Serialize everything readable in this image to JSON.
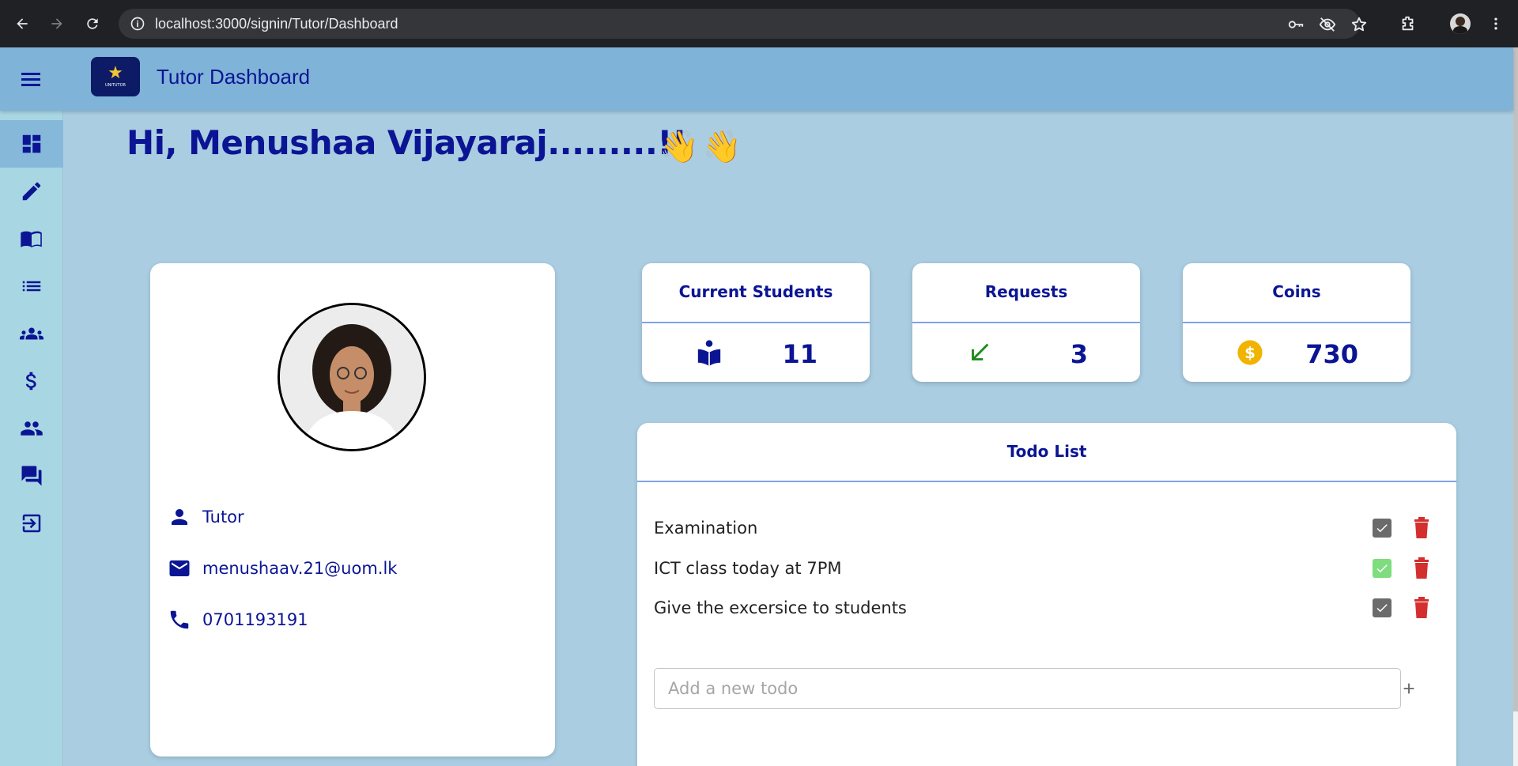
{
  "browser": {
    "url": "localhost:3000/signin/Tutor/Dashboard",
    "icons": [
      "back-icon",
      "forward-icon",
      "reload-icon",
      "site-info-icon",
      "key-icon",
      "eye-off-icon",
      "star-icon",
      "extensions-icon",
      "profile-icon",
      "more-icon"
    ]
  },
  "header": {
    "title": "Tutor Dashboard",
    "logo_brand": "UNITUTOR"
  },
  "sidebar": {
    "items": [
      {
        "name": "dashboard",
        "icon": "dashboard-icon",
        "active": true
      },
      {
        "name": "edit",
        "icon": "pencil-icon"
      },
      {
        "name": "courses",
        "icon": "book-icon"
      },
      {
        "name": "list",
        "icon": "list-icon"
      },
      {
        "name": "students",
        "icon": "groups-icon"
      },
      {
        "name": "payments",
        "icon": "dollar-icon"
      },
      {
        "name": "people",
        "icon": "people-icon"
      },
      {
        "name": "messages",
        "icon": "chat-icon"
      },
      {
        "name": "logout",
        "icon": "logout-icon"
      }
    ]
  },
  "greeting": {
    "text": "Hi, Menushaa Vijayaraj.........!!",
    "emoji1": "👋",
    "emoji2": "👋"
  },
  "profile": {
    "role": "Tutor",
    "email": "menushaav.21@uom.lk",
    "phone": "0701193191"
  },
  "stats": [
    {
      "title": "Current Students",
      "value": "11",
      "icon": "reader-icon",
      "color": "#0b1594"
    },
    {
      "title": "Requests",
      "value": "3",
      "icon": "arrow-down-left-icon",
      "color": "#1a8a1a"
    },
    {
      "title": "Coins",
      "value": "730",
      "icon": "coin-icon",
      "color": "#f0b400"
    }
  ],
  "todo": {
    "title": "Todo List",
    "items": [
      {
        "text": "Examination",
        "done_color": "#6b6b6b"
      },
      {
        "text": "ICT class today at 7PM",
        "done_color": "#7fdc7f"
      },
      {
        "text": "Give the excersice to students",
        "done_color": "#6b6b6b"
      }
    ],
    "input_placeholder": "Add a new todo",
    "input_value": ""
  },
  "colors": {
    "primary": "#0b1594",
    "header_bg": "#7fb3d8",
    "page_bg": "#aacde2",
    "delete": "#d32f2f"
  }
}
